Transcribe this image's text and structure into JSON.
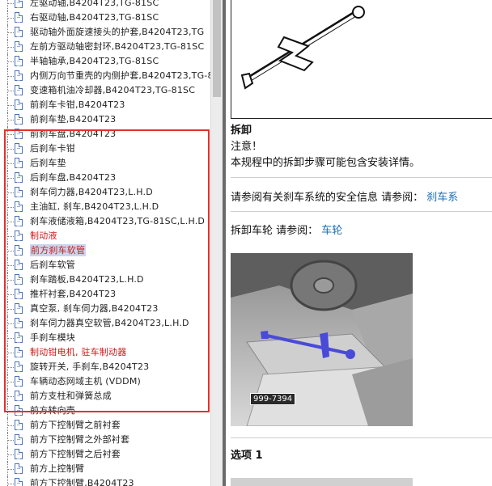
{
  "tree": {
    "items": [
      {
        "label": "左驱动轴,B4204T23,TG-81SC",
        "style": "normal"
      },
      {
        "label": "右驱动轴,B4204T23,TG-81SC",
        "style": "normal"
      },
      {
        "label": "驱动轴外面旋速接头的护套,B4204T23,TG",
        "style": "normal"
      },
      {
        "label": "左前方驱动轴密封环,B4204T23,TG-81SC",
        "style": "normal"
      },
      {
        "label": "半轴轴承,B4204T23,TG-81SC",
        "style": "normal"
      },
      {
        "label": "内侧万向节重壳的内侧护套,B4204T23,TG-8",
        "style": "normal"
      },
      {
        "label": "变速箱机油冷却器,B4204T23,TG-81SC",
        "style": "normal"
      },
      {
        "label": "前刹车卡钳,B4204T23",
        "style": "normal"
      },
      {
        "label": "前刹车垫,B4204T23",
        "style": "normal"
      },
      {
        "label": "前刹车盘,B4204T23",
        "style": "normal"
      },
      {
        "label": "后刹车卡钳",
        "style": "normal"
      },
      {
        "label": "后刹车垫",
        "style": "normal"
      },
      {
        "label": "后刹车盘,B4204T23",
        "style": "normal"
      },
      {
        "label": "刹车伺力器,B4204T23,L.H.D",
        "style": "normal"
      },
      {
        "label": "主油缸, 刹车,B4204T23,L.H.D",
        "style": "normal"
      },
      {
        "label": "刹车液储液箱,B4204T23,TG-81SC,L.H.D",
        "style": "normal"
      },
      {
        "label": "制动液",
        "style": "red"
      },
      {
        "label": "前方刹车软管",
        "style": "selected"
      },
      {
        "label": "后刹车软管",
        "style": "normal"
      },
      {
        "label": "刹车踏板,B4204T23,L.H.D",
        "style": "normal"
      },
      {
        "label": "推杆衬套,B4204T23",
        "style": "normal"
      },
      {
        "label": "真空泵, 刹车伺力器,B4204T23",
        "style": "normal"
      },
      {
        "label": "刹车伺力器真空软管,B4204T23,L.H.D",
        "style": "normal"
      },
      {
        "label": "手刹车模块",
        "style": "normal"
      },
      {
        "label": "制动钳电机, 驻车制动器",
        "style": "red"
      },
      {
        "label": "旋转开关, 手刹车,B4204T23",
        "style": "normal"
      },
      {
        "label": "车辆动态网域主机 (VDDM)",
        "style": "normal"
      },
      {
        "label": "前方支柱和弹簧总成",
        "style": "normal"
      },
      {
        "label": "前方转向壳",
        "style": "normal"
      },
      {
        "label": "前方下控制臂之前衬套",
        "style": "normal"
      },
      {
        "label": "前方下控制臂之外部衬套",
        "style": "normal"
      },
      {
        "label": "前方下控制臂之后衬套",
        "style": "normal"
      },
      {
        "label": "前方上控制臂",
        "style": "normal"
      },
      {
        "label": "前方下控制臂,B4204T23",
        "style": "normal"
      }
    ]
  },
  "content": {
    "heading": "拆卸",
    "notice": "注意！",
    "notice_text": "本规程中的拆卸步骤可能包含安装详情。",
    "safety_text": "请参阅有关刹车系统的安全信息 请参阅：",
    "safety_link": "刹车系",
    "wheel_text": "拆卸车轮 请参阅：",
    "wheel_link": "车轮",
    "photo_ref": "999-7394",
    "option_label": "选项 1"
  },
  "colors": {
    "highlight_box": "#e53030",
    "red_text": "#d01818",
    "link": "#1b6db5",
    "tool_blue": "#4a4ad8"
  }
}
